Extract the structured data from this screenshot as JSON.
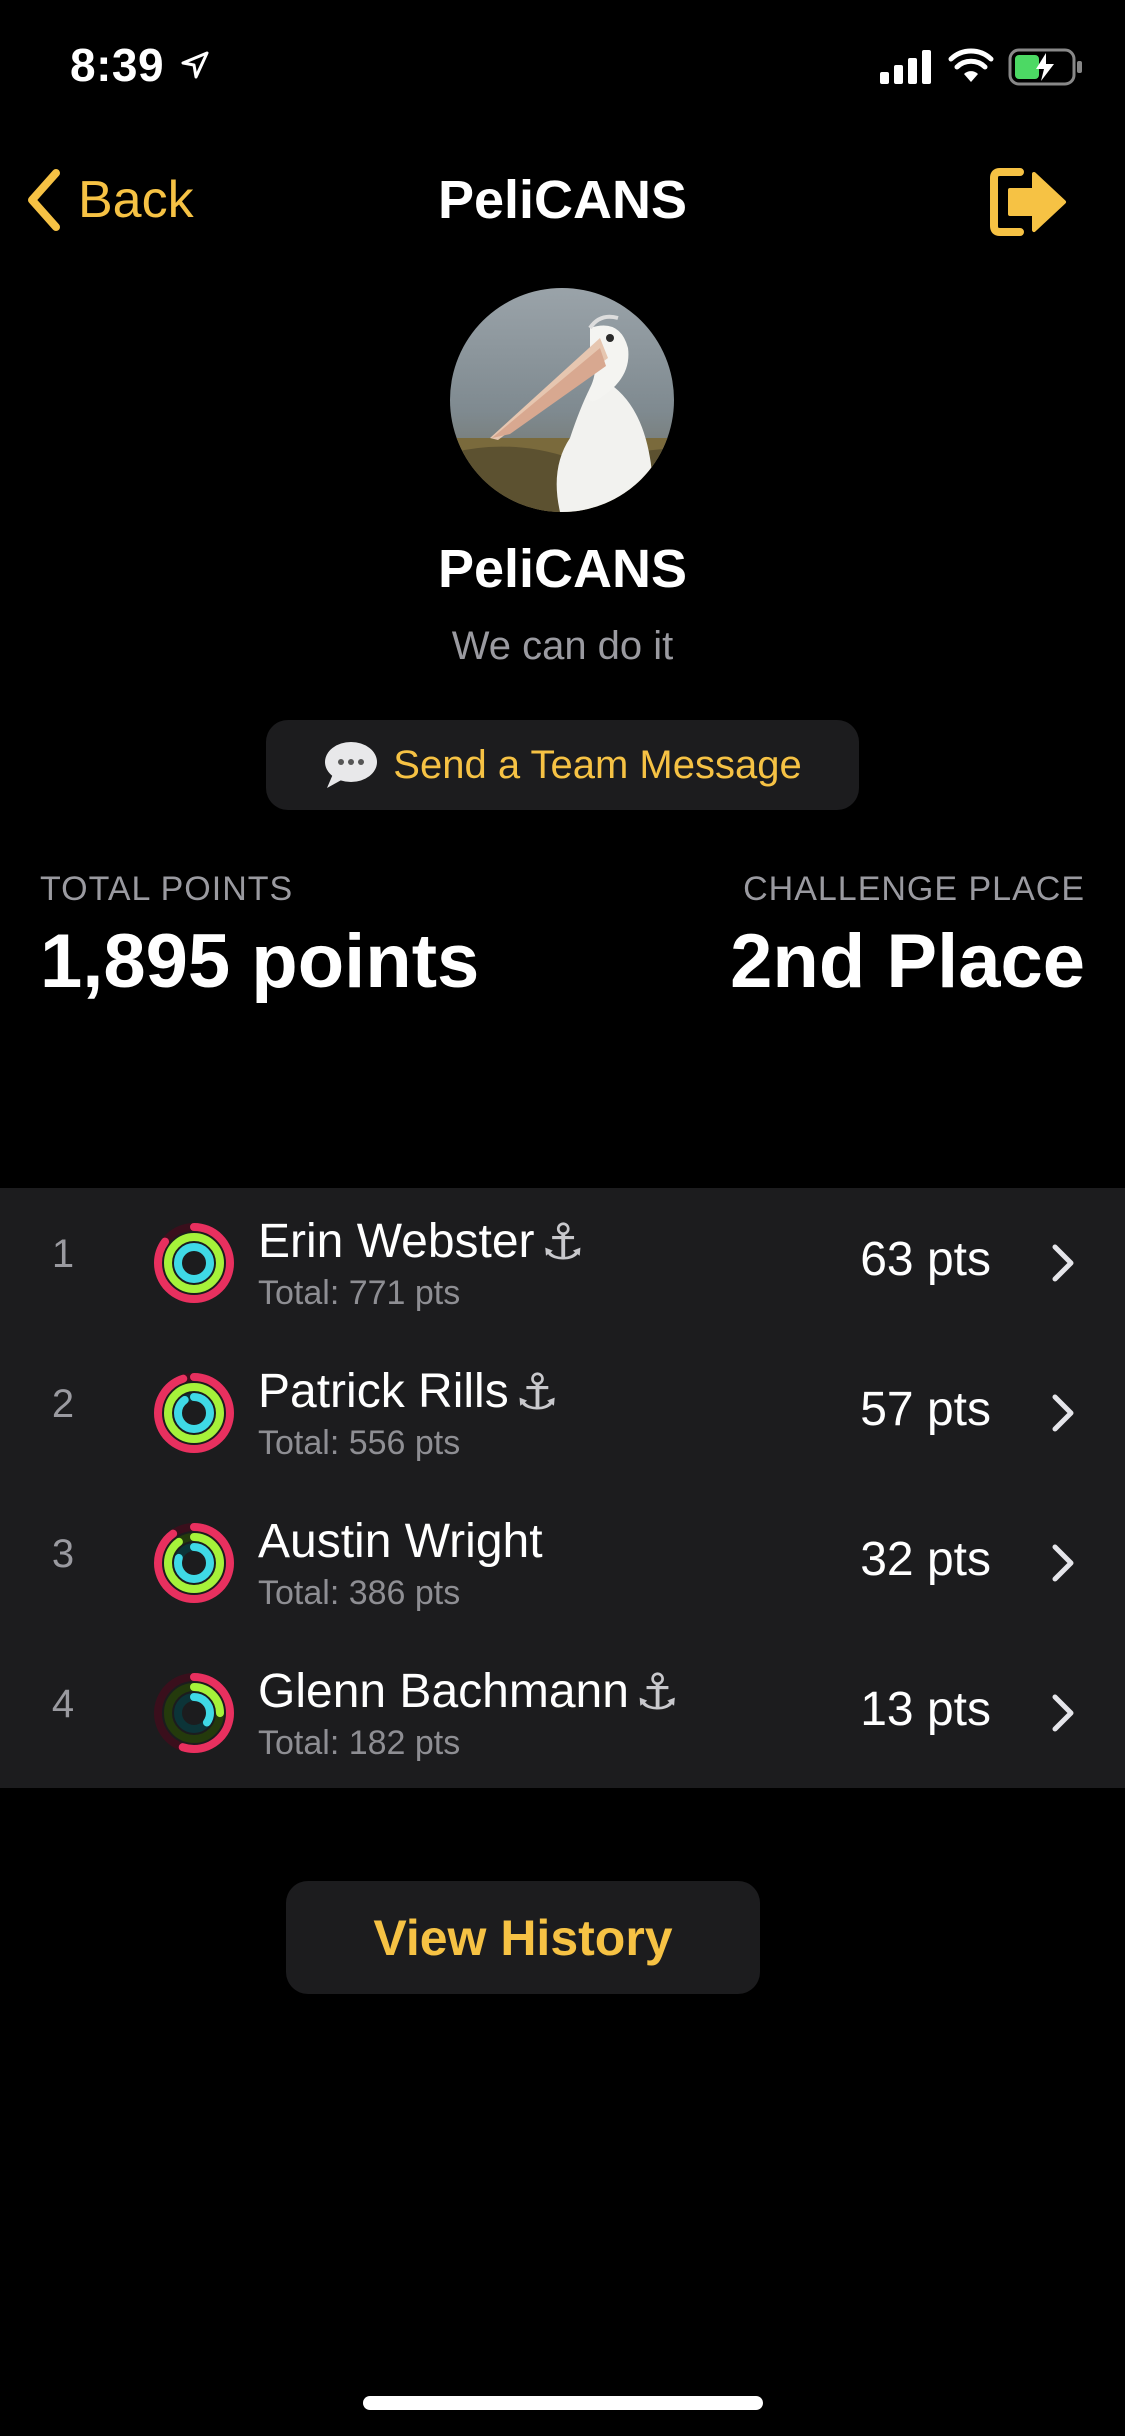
{
  "status_bar": {
    "time": "8:39",
    "icons": [
      "location-arrow-icon",
      "cellular-signal-icon",
      "wifi-icon",
      "battery-charging-icon"
    ]
  },
  "nav": {
    "back_label": "Back",
    "title": "PeliCANS",
    "leave_icon": "leave-team-icon"
  },
  "team": {
    "name": "PeliCANS",
    "motto": "We can do it",
    "message_button": "Send a Team Message",
    "message_icon": "speech-bubble-icon"
  },
  "stats": {
    "total_points_label": "TOTAL POINTS",
    "total_points_value": "1,895 points",
    "challenge_place_label": "CHALLENGE PLACE",
    "challenge_place_value": "2nd Place"
  },
  "members": [
    {
      "rank": "1",
      "name": "Erin Webster",
      "anchor": "⚓",
      "total": "Total: 771 pts",
      "points": "63 pts",
      "rings": {
        "move": 0.85,
        "exercise": 1.0,
        "stand": 1.0
      }
    },
    {
      "rank": "2",
      "name": "Patrick Rills",
      "anchor": "⚓",
      "total": "Total: 556 pts",
      "points": "57 pts",
      "rings": {
        "move": 0.95,
        "exercise": 1.0,
        "stand": 0.9
      }
    },
    {
      "rank": "3",
      "name": "Austin Wright",
      "anchor": "",
      "total": "Total: 386 pts",
      "points": "32 pts",
      "rings": {
        "move": 0.9,
        "exercise": 0.9,
        "stand": 0.8
      }
    },
    {
      "rank": "4",
      "name": "Glenn Bachmann",
      "anchor": "⚓",
      "total": "Total: 182 pts",
      "points": "13 pts",
      "rings": {
        "move": 0.55,
        "exercise": 0.25,
        "stand": 0.35
      }
    }
  ],
  "view_history_label": "View History",
  "colors": {
    "accent": "#f6c244",
    "background": "#000000",
    "card": "#1c1c1e",
    "move_ring": "#e8305f",
    "exercise_ring": "#a6f23a",
    "stand_ring": "#3fd9e6"
  }
}
